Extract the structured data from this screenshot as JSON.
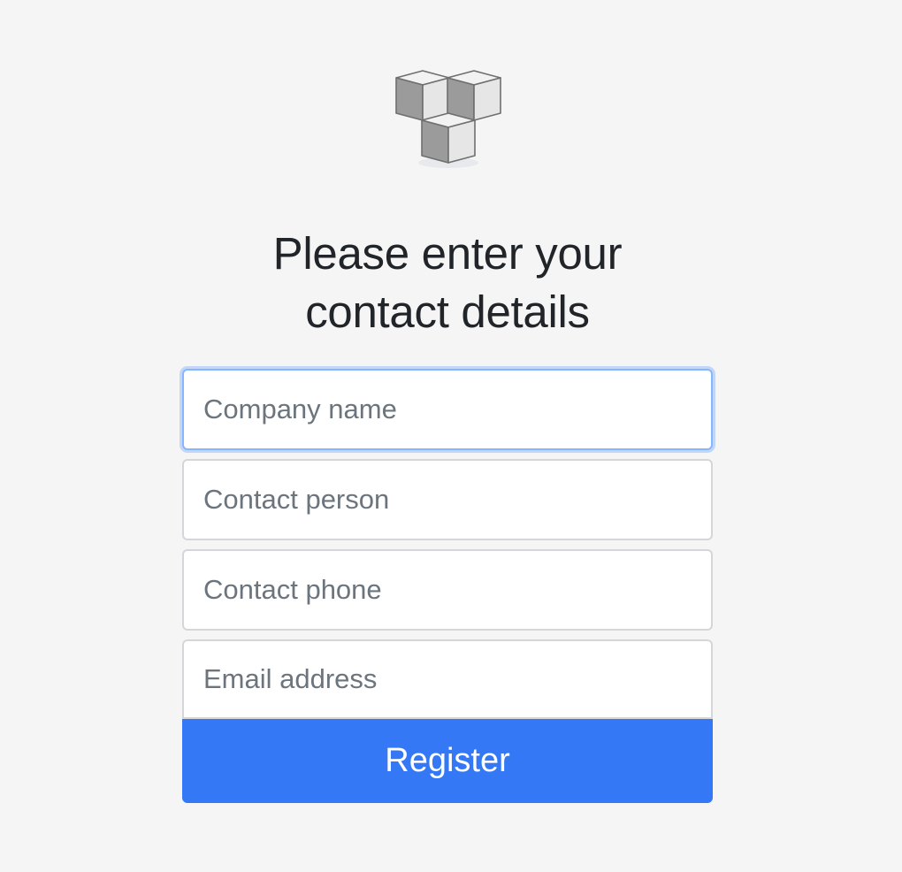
{
  "logo": {
    "icon": "cubes-logo-icon"
  },
  "heading": {
    "line1": "Please enter your",
    "line2": "contact details"
  },
  "form": {
    "company_name": {
      "placeholder": "Company name",
      "value": ""
    },
    "contact_person": {
      "placeholder": "Contact person",
      "value": ""
    },
    "contact_phone": {
      "placeholder": "Contact phone",
      "value": ""
    },
    "email_address": {
      "placeholder": "Email address",
      "value": ""
    },
    "submit_label": "Register"
  },
  "colors": {
    "background": "#f5f5f5",
    "primary": "#3478f6",
    "focus_ring": "#86b7fe",
    "text": "#212529",
    "placeholder": "#6c757d"
  }
}
